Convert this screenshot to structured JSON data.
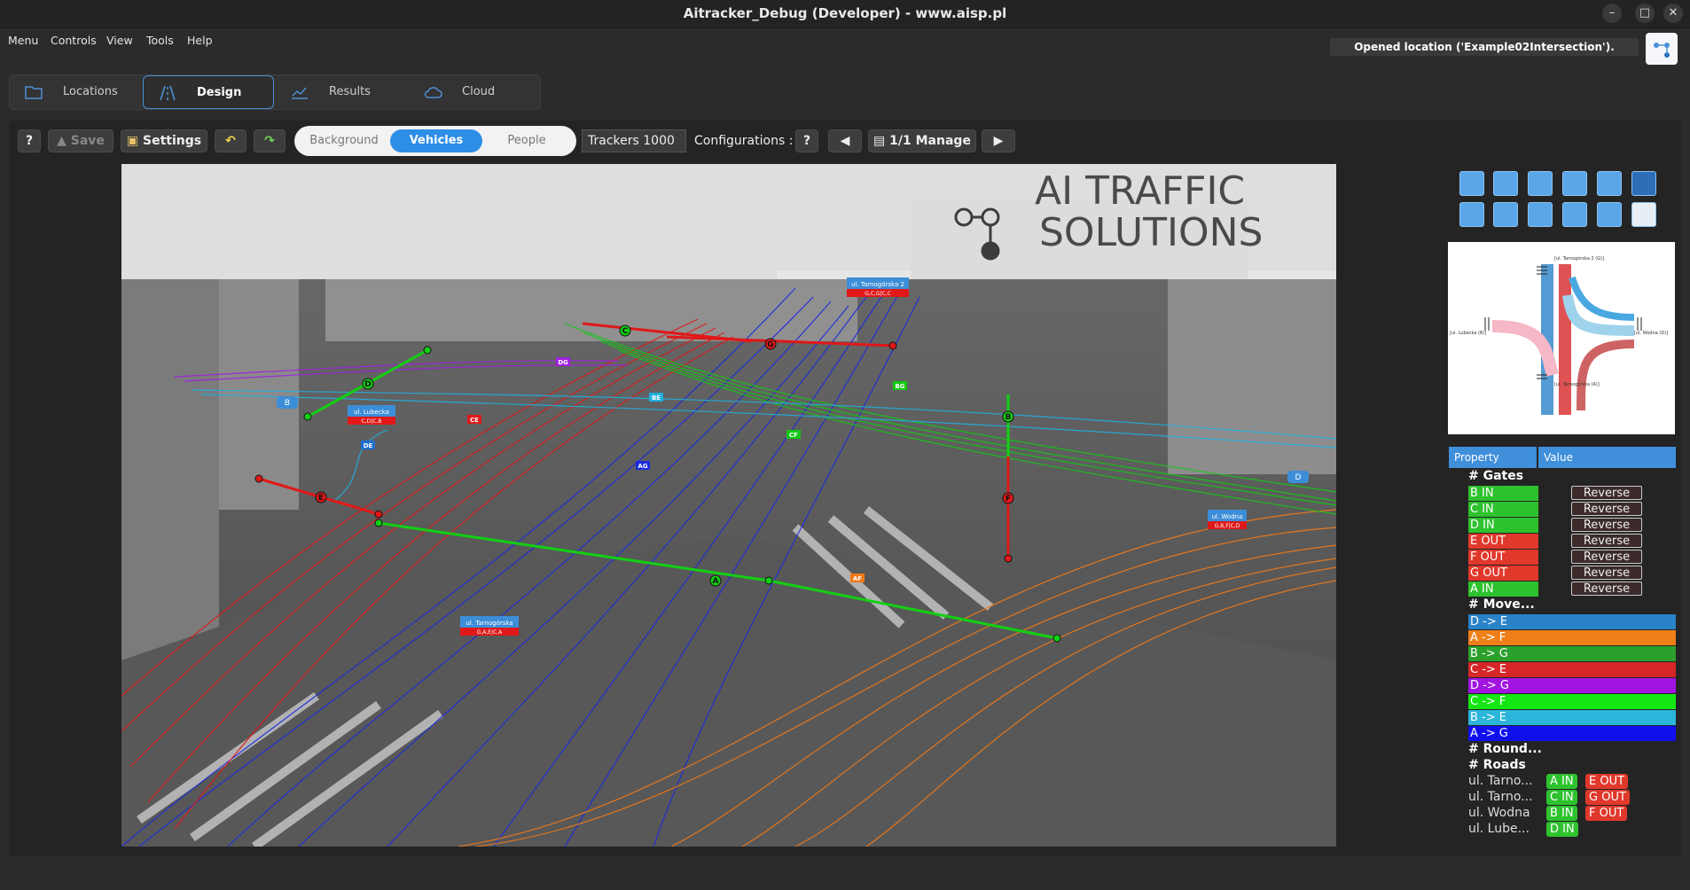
{
  "window": {
    "title": "Aitracker_Debug (Developer) - www.aisp.pl"
  },
  "menu": [
    "Menu",
    "Controls",
    "View",
    "Tools",
    "Help"
  ],
  "status": "Opened location ('Example02Intersection').",
  "nav_tabs": [
    {
      "label": "Locations",
      "icon": "folder-icon"
    },
    {
      "label": "Design",
      "icon": "road-icon",
      "active": true
    },
    {
      "label": "Results",
      "icon": "chart-icon"
    },
    {
      "label": "Cloud",
      "icon": "cloud-icon"
    }
  ],
  "toolbar": {
    "help_label": "?",
    "save_label": "Save",
    "settings_label": "Settings",
    "undo_icon": "undo-icon",
    "redo_icon": "redo-icon",
    "segments": [
      "Background",
      "Vehicles",
      "People"
    ],
    "active_segment": "Vehicles",
    "trackers_value": "Trackers 1000",
    "config_label": "Configurations :",
    "config_help": "?",
    "manage_label": "1/1 Manage"
  },
  "video": {
    "logo_line1": "AI TRAFFIC",
    "logo_line2": "SOLUTIONS",
    "roads": [
      {
        "name": "ul. Tarnogórska 2",
        "sub": "G,C,G|C,C"
      },
      {
        "name": "ul. Lubecka",
        "sub": "C,D|C,B"
      },
      {
        "name": "ul. Wodna",
        "sub": "G,B,F|C,D"
      },
      {
        "name": "ul. Tarnogórska",
        "sub": "G,A,E|C,A"
      }
    ],
    "gate_letters": [
      "A",
      "B",
      "C",
      "D",
      "E",
      "F",
      "G"
    ],
    "track_labels": [
      "DG",
      "CE",
      "DE",
      "BE",
      "AG",
      "CF",
      "BG",
      "AF"
    ],
    "colors": {
      "red": "#e01818",
      "blue": "#1b2bdc",
      "green": "#13c813",
      "orange": "#f27a18",
      "cyan": "#20b0e0",
      "purple": "#a01ee0"
    }
  },
  "tools": [
    "select-icon",
    "save-frame-icon",
    "export-icon",
    "frame-icon",
    "target-icon",
    "curve-icon",
    "region-icon",
    "magic-wand-icon",
    "line-tool-icon",
    "square-icon",
    "mountain-icon",
    "trash-icon"
  ],
  "minimap": {
    "labels": [
      "[ul. Tarnogórska 2 (G)]",
      "[ul. Lubecka (B)]",
      "[ul. Wodna (D)]",
      "[ul. Tarnogórska (A)]"
    ]
  },
  "properties": {
    "header_property": "Property",
    "header_value": "Value",
    "gates_title": "# Gates",
    "gates": [
      {
        "name": "B IN",
        "color": "#2ec22e"
      },
      {
        "name": "C IN",
        "color": "#2ec22e"
      },
      {
        "name": "D IN",
        "color": "#2ec22e"
      },
      {
        "name": "E OUT",
        "color": "#e0382b"
      },
      {
        "name": "F OUT",
        "color": "#e0382b"
      },
      {
        "name": "G OUT",
        "color": "#e0382b"
      },
      {
        "name": "A IN",
        "color": "#2ec22e"
      }
    ],
    "reverse_label": "Reverse",
    "movements_title": "# Move...",
    "movements": [
      {
        "name": "D -> E",
        "color": "#2a82c8"
      },
      {
        "name": "A -> F",
        "color": "#ef8019"
      },
      {
        "name": "B -> G",
        "color": "#2ca02c"
      },
      {
        "name": "C -> E",
        "color": "#d62728"
      },
      {
        "name": "D -> G",
        "color": "#a214e0"
      },
      {
        "name": "C -> F",
        "color": "#14e614"
      },
      {
        "name": "B -> E",
        "color": "#2bb5da"
      },
      {
        "name": "A -> G",
        "color": "#1010ee"
      }
    ],
    "round_title": "# Round...",
    "roads_title": "# Roads",
    "roads": [
      {
        "name": "ul. Tarno...",
        "in": "A IN",
        "out": "E OUT"
      },
      {
        "name": "ul. Tarno...",
        "in": "C IN",
        "out": "G OUT"
      },
      {
        "name": "ul. Wodna",
        "in": "B IN",
        "out": "F OUT"
      },
      {
        "name": "ul. Lube...",
        "in": "D IN",
        "out": ""
      }
    ]
  }
}
